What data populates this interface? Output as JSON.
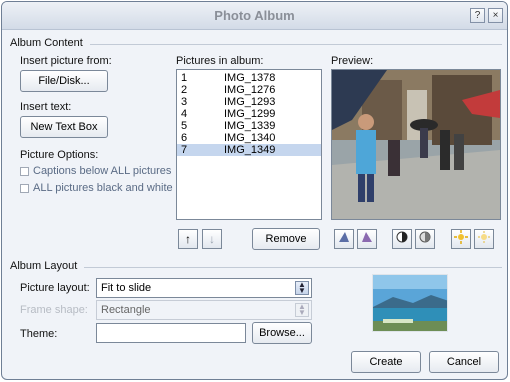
{
  "window": {
    "title": "Photo Album",
    "help_glyph": "?",
    "close_glyph": "×"
  },
  "album_content": {
    "heading": "Album Content",
    "insert_picture_label": "Insert picture from:",
    "file_disk_button": "File/Disk...",
    "insert_text_label": "Insert text:",
    "new_text_box_button": "New Text Box",
    "picture_options_label": "Picture Options:",
    "captions_option": "Captions below ALL pictures",
    "black_white_option": "ALL pictures black and white",
    "pictures_label": "Pictures in album:",
    "pictures": [
      {
        "num": "1",
        "name": "IMG_1378"
      },
      {
        "num": "2",
        "name": "IMG_1276"
      },
      {
        "num": "3",
        "name": "IMG_1293"
      },
      {
        "num": "4",
        "name": "IMG_1299"
      },
      {
        "num": "5",
        "name": "IMG_1339"
      },
      {
        "num": "6",
        "name": "IMG_1340"
      },
      {
        "num": "7",
        "name": "IMG_1349"
      }
    ],
    "selected_index": 6,
    "move_up_glyph": "↑",
    "move_down_glyph": "↓",
    "remove_button": "Remove",
    "preview_label": "Preview:"
  },
  "album_layout": {
    "heading": "Album Layout",
    "picture_layout_label": "Picture layout:",
    "picture_layout_value": "Fit to slide",
    "frame_shape_label": "Frame shape:",
    "frame_shape_value": "Rectangle",
    "theme_label": "Theme:",
    "theme_value": "",
    "browse_button": "Browse..."
  },
  "footer": {
    "create_button": "Create",
    "cancel_button": "Cancel"
  },
  "colors": {
    "selection": "#c5d6ee",
    "title_text": "#8a8f98",
    "dialog_bg": "#f0f3f8"
  }
}
